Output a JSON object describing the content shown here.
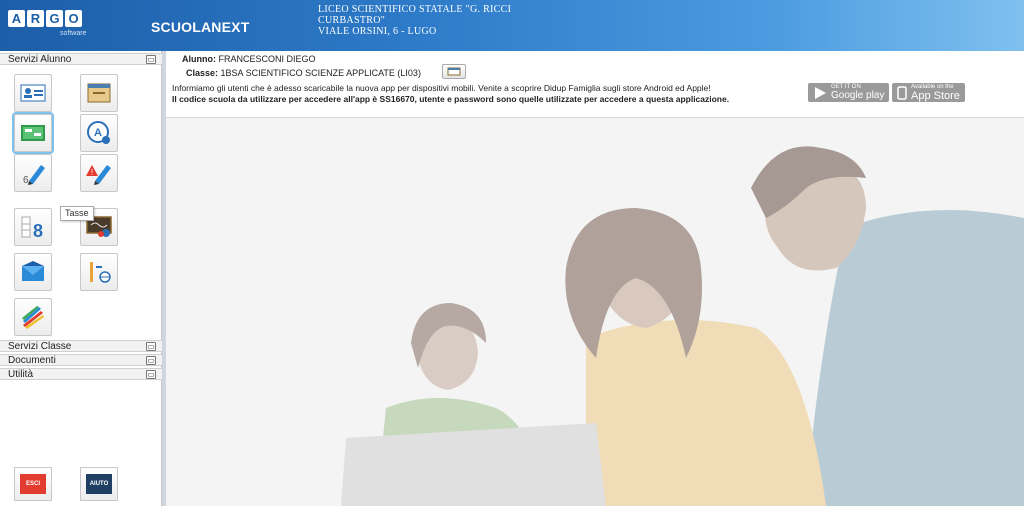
{
  "header": {
    "logo_letters": [
      "A",
      "R",
      "G",
      "O"
    ],
    "logo_sub": "software",
    "brand": "SCUOLANEXT",
    "school_line1": "LICEO SCIENTIFICO STATALE \"G. RICCI",
    "school_line2": "CURBASTRO\"",
    "school_line3": "VIALE ORSINI, 6 - LUGO"
  },
  "sidebar": {
    "section_alunno": "Servizi Alunno",
    "section_classe": "Servizi Classe",
    "section_documenti": "Documenti",
    "section_utilita": "Utilità",
    "toggle_symbol": "▭",
    "tooltip": "Tasse",
    "tiles": [
      {
        "icon": "student-card-icon"
      },
      {
        "icon": "folder-icon"
      },
      {
        "icon": "tax-icon"
      },
      {
        "icon": "circle-a-user-icon"
      },
      {
        "icon": "pencil-grade-icon"
      },
      {
        "icon": "warning-pencil-icon"
      },
      {
        "icon": "number-8-schedule-icon"
      },
      {
        "icon": "blackboard-icon"
      },
      {
        "icon": "mail-icon"
      },
      {
        "icon": "globe-note-icon"
      },
      {
        "icon": "pencils-icon"
      }
    ],
    "exit_label": "ESCI",
    "help_label": "AIUTO"
  },
  "main": {
    "student_label": "Alunno:",
    "student_name": "FRANCESCONI DIEGO",
    "class_label": "Classe:",
    "class_value": "1BSA SCIENTIFICO SCIENZE APPLICATE (LI03)",
    "message_1": "Informiamo gli utenti che è adesso scaricabile la nuova app per dispositivi mobili. Venite a scoprire Didup Famiglia sugli store Android ed Apple!",
    "message_2": "Il codice scuola da utilizzare per accedere all'app è SS16670, utente e password sono quelle utilizzate per accedere a questa applicazione.",
    "google_play_small": "GET IT ON",
    "google_play_label": "Google play",
    "app_store_small": "Available on the",
    "app_store_label": "App Store"
  },
  "colors": {
    "header_start": "#1d5ea8",
    "header_end": "#7fc0ef",
    "exit_red": "#e23b2f",
    "help_navy": "#1f3f63"
  }
}
